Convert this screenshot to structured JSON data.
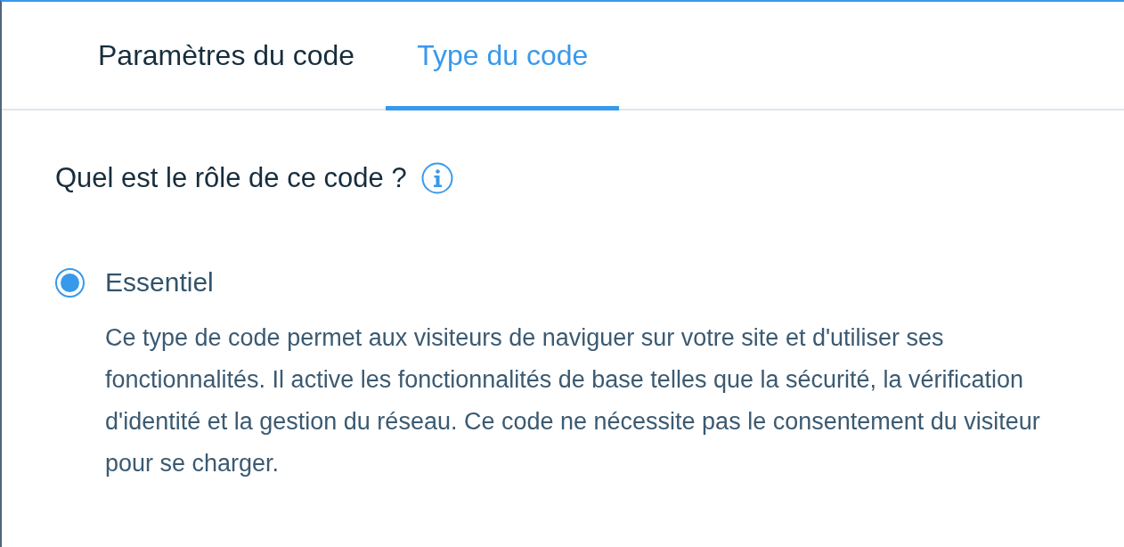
{
  "tabs": [
    {
      "label": "Paramètres du code",
      "selected": false
    },
    {
      "label": "Type du code",
      "selected": true
    }
  ],
  "question": {
    "text": "Quel est le rôle de ce code ?"
  },
  "options": [
    {
      "label": "Essentiel",
      "selected": true,
      "description": "Ce type de code permet aux visiteurs de naviguer sur votre site et d'utiliser ses fonctionnalités. Il active les fonctionnalités de base telles que la sécurité, la vérification d'identité et la gestion du réseau. Ce code ne nécessite pas le consentement du visiteur pour se charger."
    }
  ]
}
